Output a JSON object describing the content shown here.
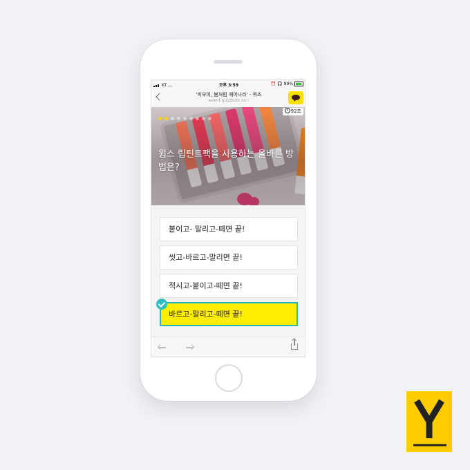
{
  "status_bar": {
    "carrier": "KT",
    "time": "오후 3:59",
    "battery": "89%"
  },
  "browser": {
    "title": "'피부여, 봄처럼 깨어나라' - 퀴즈",
    "url": "event.quizbuzz.co"
  },
  "quiz": {
    "timer": "92초",
    "question": "윕스 립틴트팩을 사용하는 올바른 방법은?",
    "answers": [
      {
        "label": "붙이고- 말리고-떼면 끝!",
        "selected": false
      },
      {
        "label": "씻고-바르고-말리면 끝!",
        "selected": false
      },
      {
        "label": "적시고-붙이고-떼면 끝!",
        "selected": false
      },
      {
        "label": "바르고-말리고-떼면 끝!",
        "selected": true
      }
    ]
  },
  "colors": {
    "selected_answer": "#ffed00",
    "check_accent": "#2bbfc0",
    "kakao_yellow": "#fae100",
    "logo_yellow": "#ffcc00"
  },
  "icons": [
    "back-chevron-icon",
    "kakaotalk-icon",
    "clock-icon",
    "check-icon",
    "back-arrow-icon",
    "forward-arrow-icon",
    "share-icon",
    "yanolja-logo"
  ]
}
